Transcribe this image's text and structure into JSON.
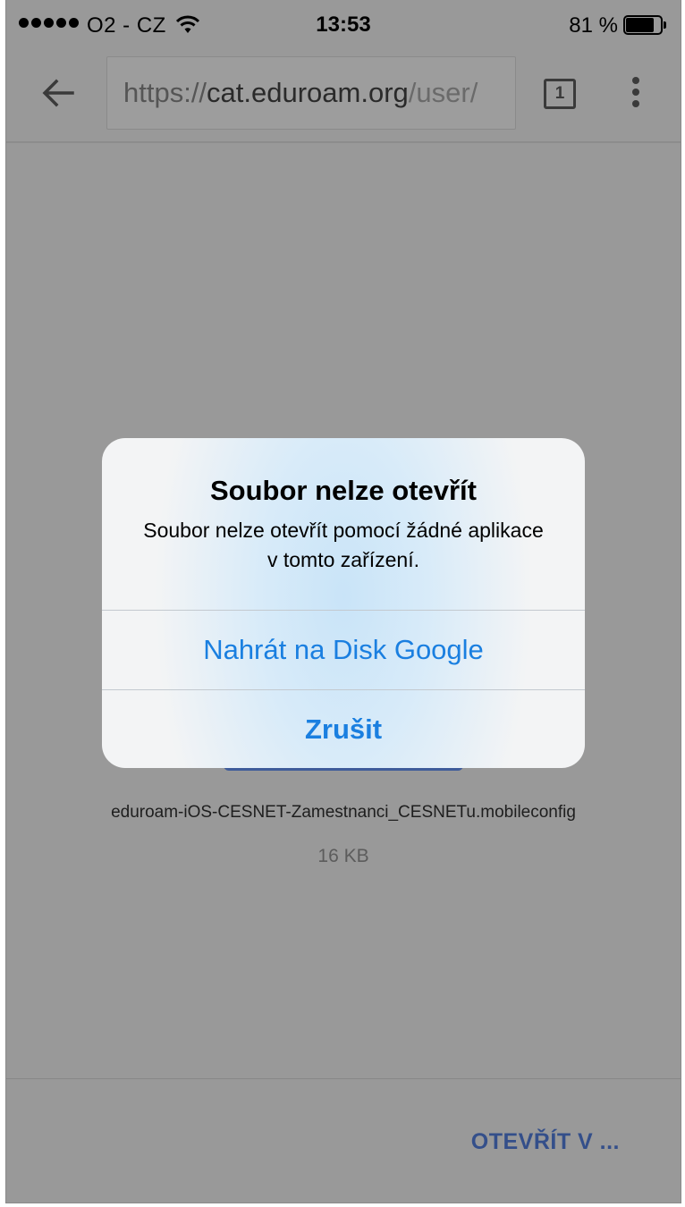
{
  "status_bar": {
    "carrier": "O2 - CZ",
    "time": "13:53",
    "battery_percent": "81 %",
    "battery_level": 0.81
  },
  "toolbar": {
    "url_scheme": "https://",
    "url_host": "cat.eduroam.org",
    "url_path": "/user/",
    "tab_count": "1"
  },
  "page": {
    "file_name": "eduroam-iOS-CESNET-Zamestnanci_CESNETu.mobileconfig",
    "file_size": "16 KB"
  },
  "bottom_bar": {
    "open_in_label": "OTEVŘÍT V ..."
  },
  "alert": {
    "title": "Soubor nelze otevřít",
    "message": "Soubor nelze otevřít pomocí žádné aplikace v tomto zařízení.",
    "upload_label": "Nahrát na Disk Google",
    "cancel_label": "Zrušit"
  },
  "colors": {
    "accent": "#1a7fe0",
    "overlay": "#999999",
    "open_in": "#344f8a"
  }
}
